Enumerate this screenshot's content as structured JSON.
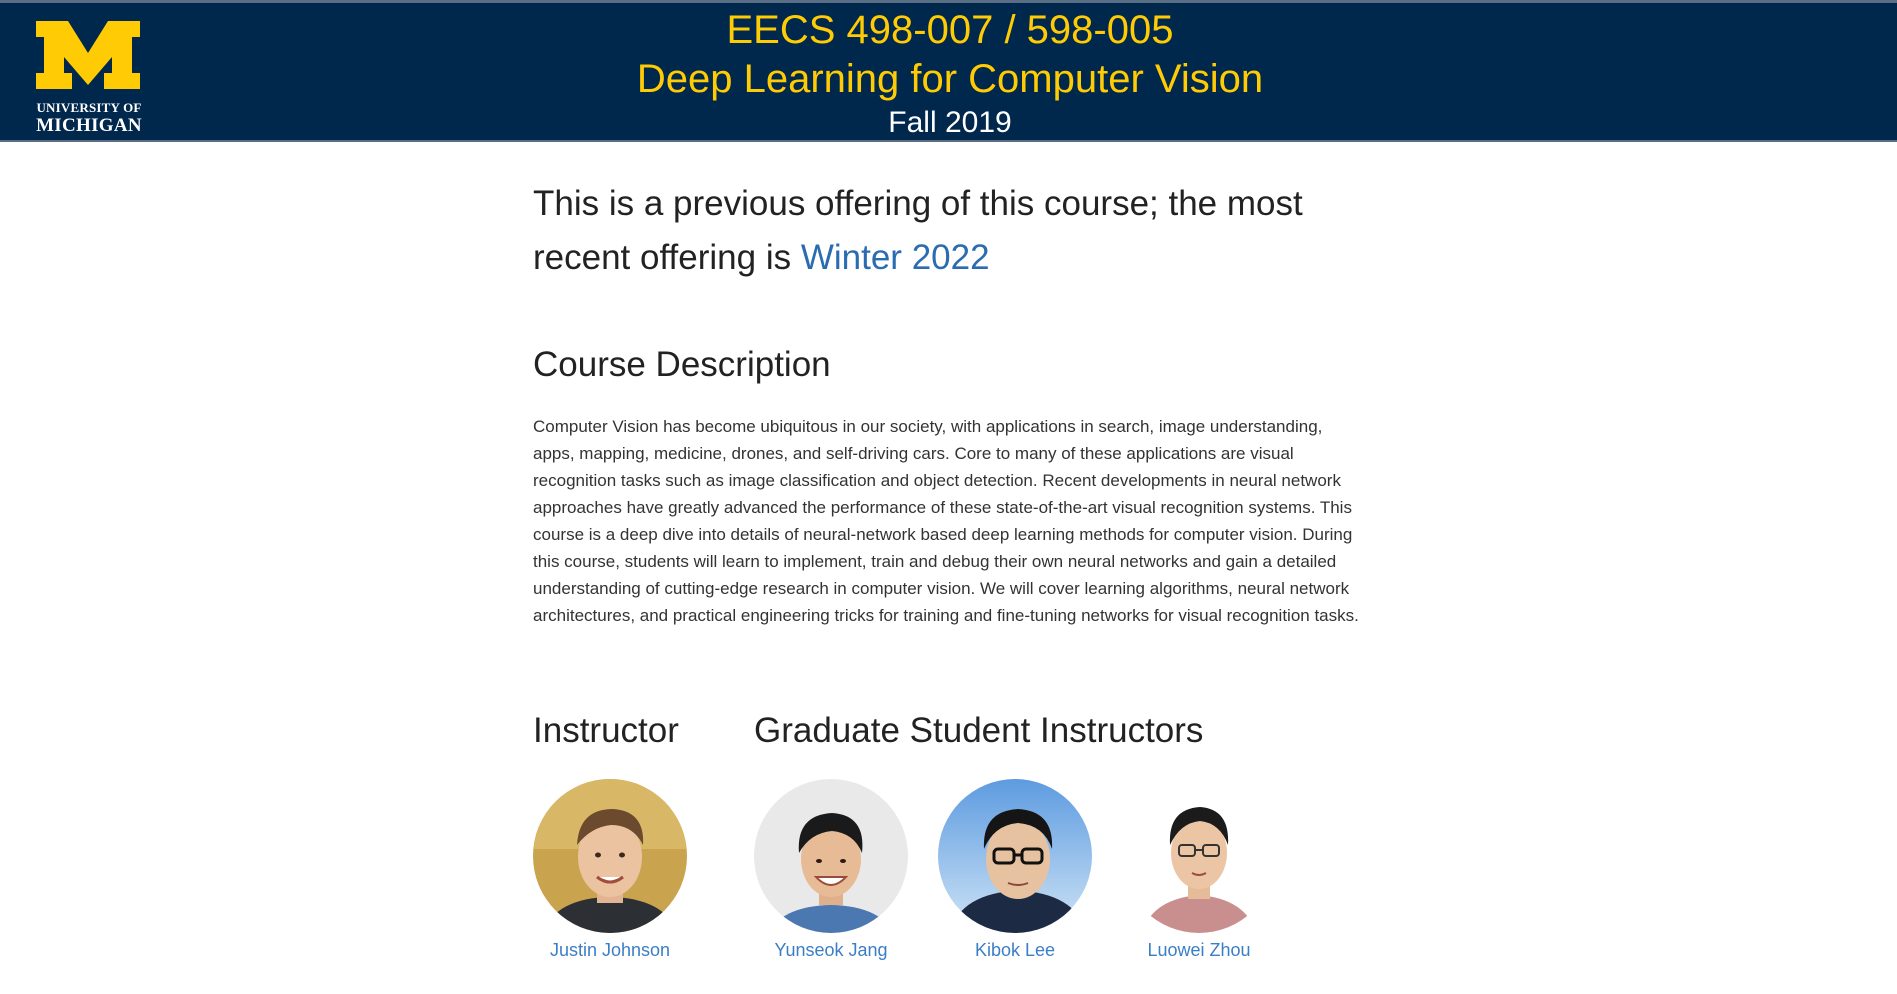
{
  "header": {
    "logo_line1": "UNIVERSITY OF",
    "logo_line2": "MICHIGAN",
    "course_code": "EECS 498-007 / 598-005",
    "course_title": "Deep Learning for Computer Vision",
    "term": "Fall 2019"
  },
  "notice": {
    "text": "This is a previous offering of this course; the most recent offering is ",
    "link_label": "Winter 2022"
  },
  "description": {
    "heading": "Course Description",
    "body": "Computer Vision has become ubiquitous in our society, with applications in search, image understanding, apps, mapping, medicine, drones, and self-driving cars. Core to many of these applications are visual recognition tasks such as image classification and object detection. Recent developments in neural network approaches have greatly advanced the performance of these state-of-the-art visual recognition systems. This course is a deep dive into details of neural-network based deep learning methods for computer vision. During this course, students will learn to implement, train and debug their own neural networks and gain a detailed understanding of cutting-edge research in computer vision. We will cover learning algorithms, neural network architectures, and practical engineering tricks for training and fine-tuning networks for visual recognition tasks."
  },
  "staff": {
    "instructor_heading": "Instructor",
    "gsi_heading": "Graduate Student Instructors",
    "people": [
      {
        "name": "Justin Johnson"
      },
      {
        "name": "Yunseok Jang"
      },
      {
        "name": "Kibok Lee"
      },
      {
        "name": "Luowei Zhou"
      }
    ]
  },
  "colors": {
    "header_bg": "#00274c",
    "maize": "#ffcb05",
    "link": "#2b6cb0"
  }
}
